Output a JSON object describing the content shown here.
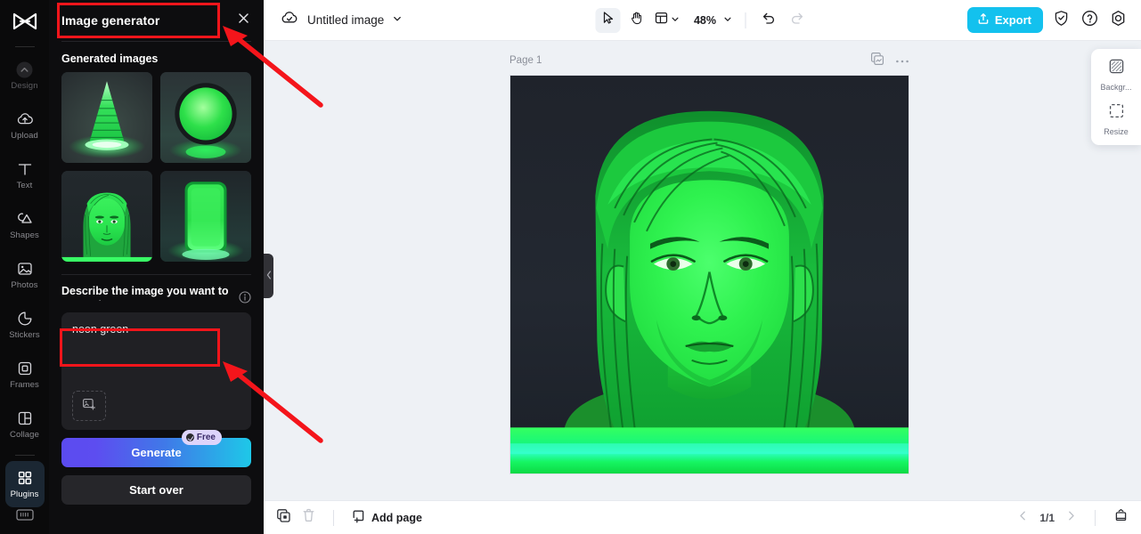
{
  "app": {
    "brand_icon": "capcut-logo-icon",
    "accent_blue": "#13c1ee",
    "annotation_color": "#f4151b"
  },
  "rail": {
    "items": [
      {
        "label": "Design",
        "icon": "chevron-up-circle-icon",
        "state": "dimmed"
      },
      {
        "label": "Upload",
        "icon": "cloud-upload-icon",
        "state": "normal"
      },
      {
        "label": "Text",
        "icon": "text-t-icon",
        "state": "normal"
      },
      {
        "label": "Shapes",
        "icon": "shapes-icon",
        "state": "normal"
      },
      {
        "label": "Photos",
        "icon": "photo-icon",
        "state": "normal"
      },
      {
        "label": "Stickers",
        "icon": "sticker-icon",
        "state": "normal"
      },
      {
        "label": "Frames",
        "icon": "frame-icon",
        "state": "normal"
      },
      {
        "label": "Collage",
        "icon": "collage-icon",
        "state": "normal"
      },
      {
        "label": "Plugins",
        "icon": "plugins-grid-icon",
        "state": "active"
      }
    ],
    "bottom_icon": "keyboard-icon"
  },
  "panel": {
    "title": "Image generator",
    "close_icon": "close-icon",
    "section_title": "Generated images",
    "thumbnails": [
      {
        "name": "neon-green-cone-tree",
        "alt": "Neon green stacked cone"
      },
      {
        "name": "neon-green-circle-button",
        "alt": "Glowing green circle"
      },
      {
        "name": "neon-green-portrait",
        "alt": "Neon green portrait of a man"
      },
      {
        "name": "neon-green-rounded-slab",
        "alt": "Glowing green rounded rectangle"
      }
    ],
    "describe_label": "Describe the image you want to generate",
    "info_icon": "info-icon",
    "prompt_value": "neon green",
    "prompt_placeholder": "Describe the image you want to generate",
    "add_image_icon": "add-image-icon",
    "generate_label": "Generate",
    "free_badge": "Free",
    "start_over_label": "Start over",
    "collapse_icon": "chevron-left-icon"
  },
  "topbar": {
    "cloud_icon": "cloud-saved-icon",
    "doc_title": "Untitled image",
    "title_caret_icon": "chevron-down-icon",
    "tools": [
      {
        "name": "select-tool",
        "icon": "cursor-arrow-icon",
        "selected": true
      },
      {
        "name": "hand-tool",
        "icon": "hand-icon",
        "selected": false
      },
      {
        "name": "layout-tool",
        "icon": "layout-panel-icon",
        "selected": false
      }
    ],
    "zoom_level": "48%",
    "undo_icon": "undo-icon",
    "redo_icon": "redo-icon",
    "export_label": "Export",
    "export_icon": "upload-box-icon",
    "shield_icon": "shield-check-icon",
    "help_icon": "question-circle-icon",
    "settings_icon": "gear-icon"
  },
  "canvas": {
    "page_label": "Page 1",
    "duplicate_page_icon": "duplicate-page-icon",
    "more_icon": "ellipsis-icon",
    "artwork_name": "neon-green-portrait-large",
    "artwork_alt": "Neon green stylized portrait of a long-haired man on dark background"
  },
  "right_dock": {
    "items": [
      {
        "label": "Backgr...",
        "icon": "background-checker-icon",
        "name": "background-tool"
      },
      {
        "label": "Resize",
        "icon": "resize-icon",
        "name": "resize-tool"
      }
    ]
  },
  "bottombar": {
    "duplicate_icon": "duplicate-icon",
    "delete_icon": "trash-icon",
    "add_page_label": "Add page",
    "add_page_icon": "add-page-icon",
    "prev_icon": "chevron-left-icon",
    "page_indicator": "1/1",
    "next_icon": "chevron-right-icon",
    "grid_view_icon": "page-grid-icon"
  },
  "annotations": [
    {
      "name": "highlight-panel-title",
      "type": "rect"
    },
    {
      "name": "highlight-prompt-input",
      "type": "rect"
    },
    {
      "name": "arrow-to-panel-title",
      "type": "arrow"
    },
    {
      "name": "arrow-to-prompt-input",
      "type": "arrow"
    }
  ]
}
